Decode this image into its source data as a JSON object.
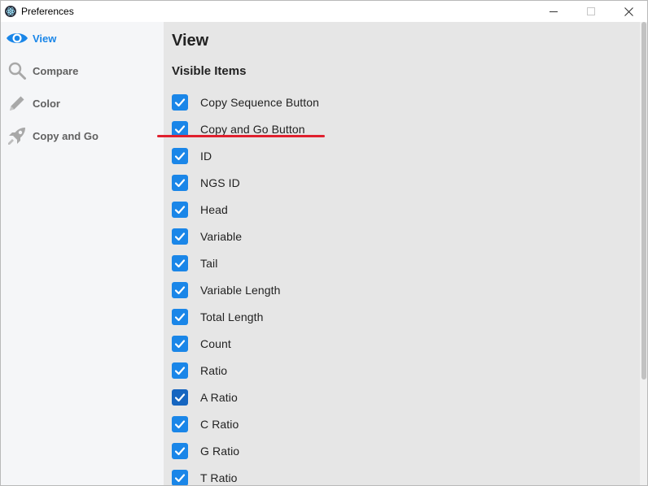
{
  "window": {
    "title": "Preferences",
    "app_icon": "electron-icon"
  },
  "controls": {
    "minimize": "minimize-icon",
    "maximize": "maximize-icon",
    "close": "close-icon"
  },
  "sidebar": {
    "items": [
      {
        "label": "View",
        "icon": "eye-icon",
        "active": true
      },
      {
        "label": "Compare",
        "icon": "search-icon",
        "active": false
      },
      {
        "label": "Color",
        "icon": "pencil-icon",
        "active": false
      },
      {
        "label": "Copy and Go",
        "icon": "rocket-icon",
        "active": false
      }
    ]
  },
  "main": {
    "title": "View",
    "section_title": "Visible Items",
    "items": [
      {
        "label": "Copy Sequence Button",
        "checked": true
      },
      {
        "label": "Copy and Go Button",
        "checked": true
      },
      {
        "label": "ID",
        "checked": true
      },
      {
        "label": "NGS ID",
        "checked": true
      },
      {
        "label": "Head",
        "checked": true
      },
      {
        "label": "Variable",
        "checked": true
      },
      {
        "label": "Tail",
        "checked": true
      },
      {
        "label": "Variable Length",
        "checked": true
      },
      {
        "label": "Total Length",
        "checked": true
      },
      {
        "label": "Count",
        "checked": true
      },
      {
        "label": "Ratio",
        "checked": true
      },
      {
        "label": "A Ratio",
        "checked": true
      },
      {
        "label": "C Ratio",
        "checked": true
      },
      {
        "label": "G Ratio",
        "checked": true
      },
      {
        "label": "T Ratio",
        "checked": true
      }
    ]
  },
  "colors": {
    "accent": "#1a86e8",
    "annotation": "#e0202e",
    "sidebar_bg": "#f5f6f8",
    "main_bg": "#e6e6e6"
  }
}
